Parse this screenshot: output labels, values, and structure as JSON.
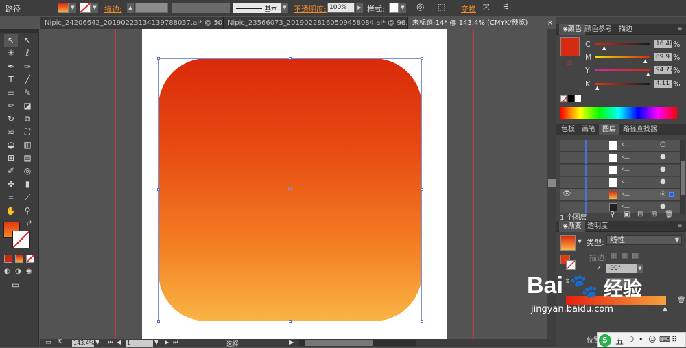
{
  "control_bar": {
    "object_type": "路径",
    "stroke_label": "描边:",
    "stroke_profile": "基本",
    "opacity_label": "不透明度:",
    "opacity_value": "100%",
    "style_label": "样式:",
    "transform_label": "变换"
  },
  "doc_tabs": [
    {
      "label": "Nipic_24206642_20190223134139788037.ai* @ 50...",
      "close": "×"
    },
    {
      "label": "Nipic_23566073_20190228160509458084.ai* @ 98...",
      "close": "×"
    },
    {
      "label": "未标题-14* @ 143.4% (CMYK/预览)",
      "close": "×"
    }
  ],
  "status_bar": {
    "zoom": "143.4%",
    "artboard_number": "1",
    "tool_status": "选择"
  },
  "color_panel": {
    "tabs": [
      "颜色",
      "颜色参考",
      "描边"
    ],
    "channels": [
      {
        "name": "C",
        "value": "16.48"
      },
      {
        "name": "M",
        "value": "89.9"
      },
      {
        "name": "Y",
        "value": "94.77"
      },
      {
        "name": "K",
        "value": "4.11"
      }
    ],
    "fill_color": "#d62b12"
  },
  "layers_panel": {
    "tabs": [
      "色板",
      "画笔",
      "图层",
      "路径查找器"
    ],
    "rows": [
      "‹...",
      "‹...",
      "‹...",
      "‹...",
      "‹...",
      "‹..."
    ],
    "footer": "1 个图层"
  },
  "gradient_panel": {
    "tabs": [
      "渐变",
      "透明度"
    ],
    "type_label": "类型:",
    "type_value": "线性",
    "stroke_label": "描边:",
    "angle": "-90°",
    "position_label": "位置"
  },
  "watermark": {
    "logo": "Bai",
    "logo_cn": "经验",
    "url": "jingyan.baidu.com"
  },
  "ime_bar": {
    "mode": "五"
  },
  "colors": {
    "gradient_top": "#d92a0a",
    "gradient_bottom": "#fab445",
    "guide": "#b84040",
    "selection": "#7d8fd6"
  }
}
